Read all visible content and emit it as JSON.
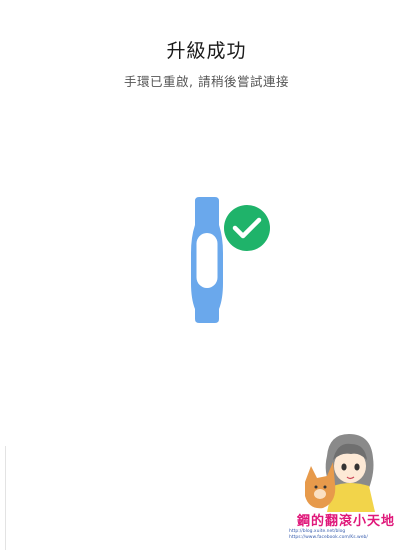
{
  "status": {
    "title": "升級成功",
    "subtitle": "手環已重啟, 請稍後嘗試連接"
  },
  "illustration": {
    "band_icon": "fitness-band-icon",
    "check_icon": "check-circle-icon",
    "band_color": "#6aa8ec",
    "check_color": "#1fb36a"
  },
  "watermark": {
    "title": "鋼的翻滾小天地",
    "url_blog": "http://blog.xuite.net/blog",
    "url_facebook": "https://www.facebook.com/Ks.web/"
  }
}
